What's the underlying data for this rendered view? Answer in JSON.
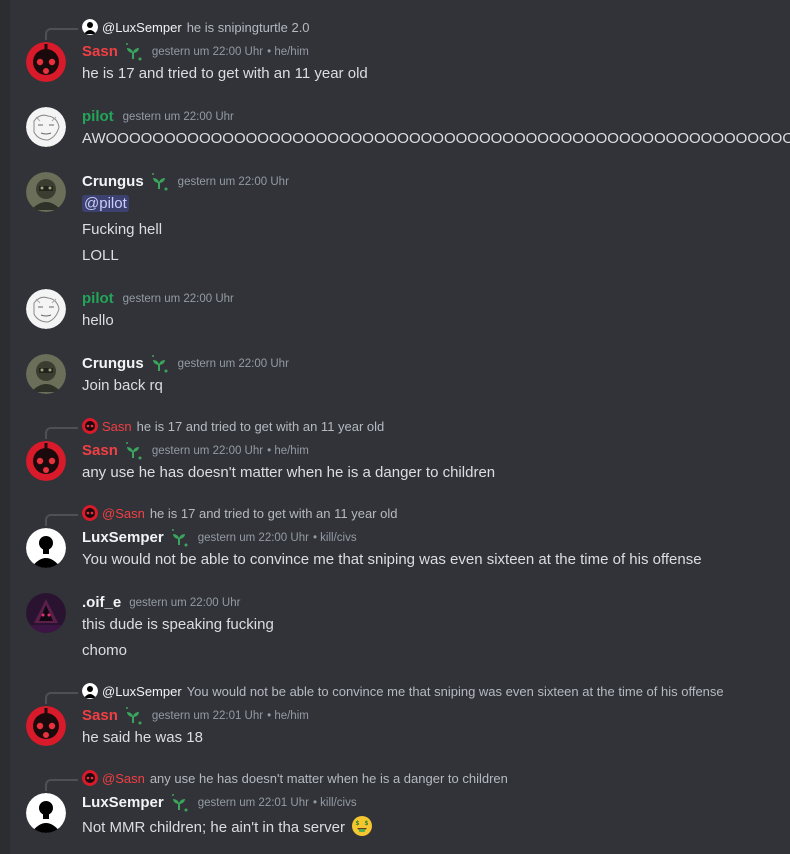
{
  "colors": {
    "sasn": "#f23f43",
    "pilot": "#23a559",
    "default_name": "#f2f3f5",
    "mention_bg": "#3c4270",
    "sprout": "#3ba55d"
  },
  "messages": [
    {
      "reply": {
        "name": "@LuxSemper",
        "text": "he is snipingturtle 2.0",
        "avatar": "lux"
      },
      "author": "Sasn",
      "avatar": "sasn",
      "badge": "sprout-icon",
      "timestamp": "gestern um 22:00 Uhr",
      "pronouns": "• he/him",
      "lines": [
        "he is 17 and tried to get with an 11 year old"
      ]
    },
    {
      "author": "pilot",
      "avatar": "pilot",
      "timestamp": "gestern um 22:00 Uhr",
      "lines": [
        "AWOOOOOOOOOOOOOOOOOOOOOOOOOOOOOOOOOOOOOOOOOOOOOOOOOOOOOOOOOOOOOOOOO"
      ]
    },
    {
      "author": "Crungus",
      "avatar": "crungus",
      "badge": "sprout-icon",
      "timestamp": "gestern um 22:00 Uhr",
      "mention": "@pilot",
      "lines": [
        "Fucking hell",
        "LOLL"
      ]
    },
    {
      "author": "pilot",
      "avatar": "pilot",
      "timestamp": "gestern um 22:00 Uhr",
      "lines": [
        "hello"
      ]
    },
    {
      "author": "Crungus",
      "avatar": "crungus",
      "badge": "sprout-icon",
      "timestamp": "gestern um 22:00 Uhr",
      "lines": [
        "Join back rq"
      ]
    },
    {
      "reply": {
        "name": "Sasn",
        "text": "he is 17 and tried to get with an 11 year old",
        "avatar": "sasn"
      },
      "author": "Sasn",
      "avatar": "sasn",
      "badge": "sprout-icon",
      "timestamp": "gestern um 22:00 Uhr",
      "pronouns": "• he/him",
      "lines": [
        "any use he has doesn't matter when he is a danger to children"
      ]
    },
    {
      "reply": {
        "name": "@Sasn",
        "text": "he is 17 and tried to get with an 11 year old",
        "avatar": "sasn"
      },
      "author": "LuxSemper",
      "avatar": "lux",
      "badge": "sprout-icon",
      "timestamp": "gestern um 22:00 Uhr",
      "pronouns": "• kill/civs",
      "lines": [
        "You would not be able to convince me that sniping was even sixteen at the time of his offense"
      ]
    },
    {
      "author": ".oif_e",
      "avatar": "oif",
      "timestamp": "gestern um 22:00 Uhr",
      "lines": [
        "this dude is speaking fucking",
        "chomo"
      ]
    },
    {
      "reply": {
        "name": "@LuxSemper",
        "text": "You would not be able to convince me that sniping was even sixteen at the time of his offense",
        "avatar": "lux"
      },
      "author": "Sasn",
      "avatar": "sasn",
      "badge": "sprout-icon",
      "timestamp": "gestern um 22:01 Uhr",
      "pronouns": "• he/him",
      "lines": [
        "he said he was 18"
      ]
    },
    {
      "reply": {
        "name": "@Sasn",
        "text": "any use he has doesn't matter when he is a danger to children",
        "avatar": "sasn"
      },
      "author": "LuxSemper",
      "avatar": "lux",
      "badge": "sprout-icon",
      "timestamp": "gestern um 22:01 Uhr",
      "pronouns": "• kill/civs",
      "lines": [
        "Not MMR children; he ain't in tha server"
      ],
      "emoji": "money-mouth-face-icon"
    }
  ]
}
